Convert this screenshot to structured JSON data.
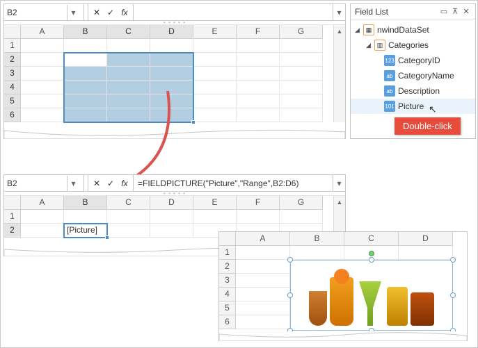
{
  "top": {
    "namebox": "B2",
    "formula": "",
    "columns": [
      "A",
      "B",
      "C",
      "D",
      "E",
      "F",
      "G"
    ],
    "rows": [
      "1",
      "2",
      "3",
      "4",
      "5",
      "6"
    ],
    "sel": {
      "r0": 1,
      "c0": 1,
      "r1": 5,
      "c1": 3
    }
  },
  "fieldlist": {
    "title": "Field List",
    "ds": "nwindDataSet",
    "table": "Categories",
    "fields": [
      {
        "kind": "num",
        "label": "CategoryID"
      },
      {
        "kind": "txt",
        "label": "CategoryName"
      },
      {
        "kind": "txt",
        "label": "Description"
      },
      {
        "kind": "img",
        "label": "Picture",
        "active": true
      }
    ]
  },
  "callout": "Double-click",
  "bottom": {
    "namebox": "B2",
    "formula": "=FIELDPICTURE(\"Picture\",\"Range\",B2:D6)",
    "columns": [
      "A",
      "B",
      "C",
      "D",
      "E",
      "F",
      "G"
    ],
    "rows": [
      "1",
      "2"
    ],
    "cellB2": "[Picture]"
  },
  "mini": {
    "columns": [
      "A",
      "B",
      "C",
      "D"
    ],
    "rows": [
      "1",
      "2",
      "3",
      "4",
      "5",
      "6"
    ]
  }
}
